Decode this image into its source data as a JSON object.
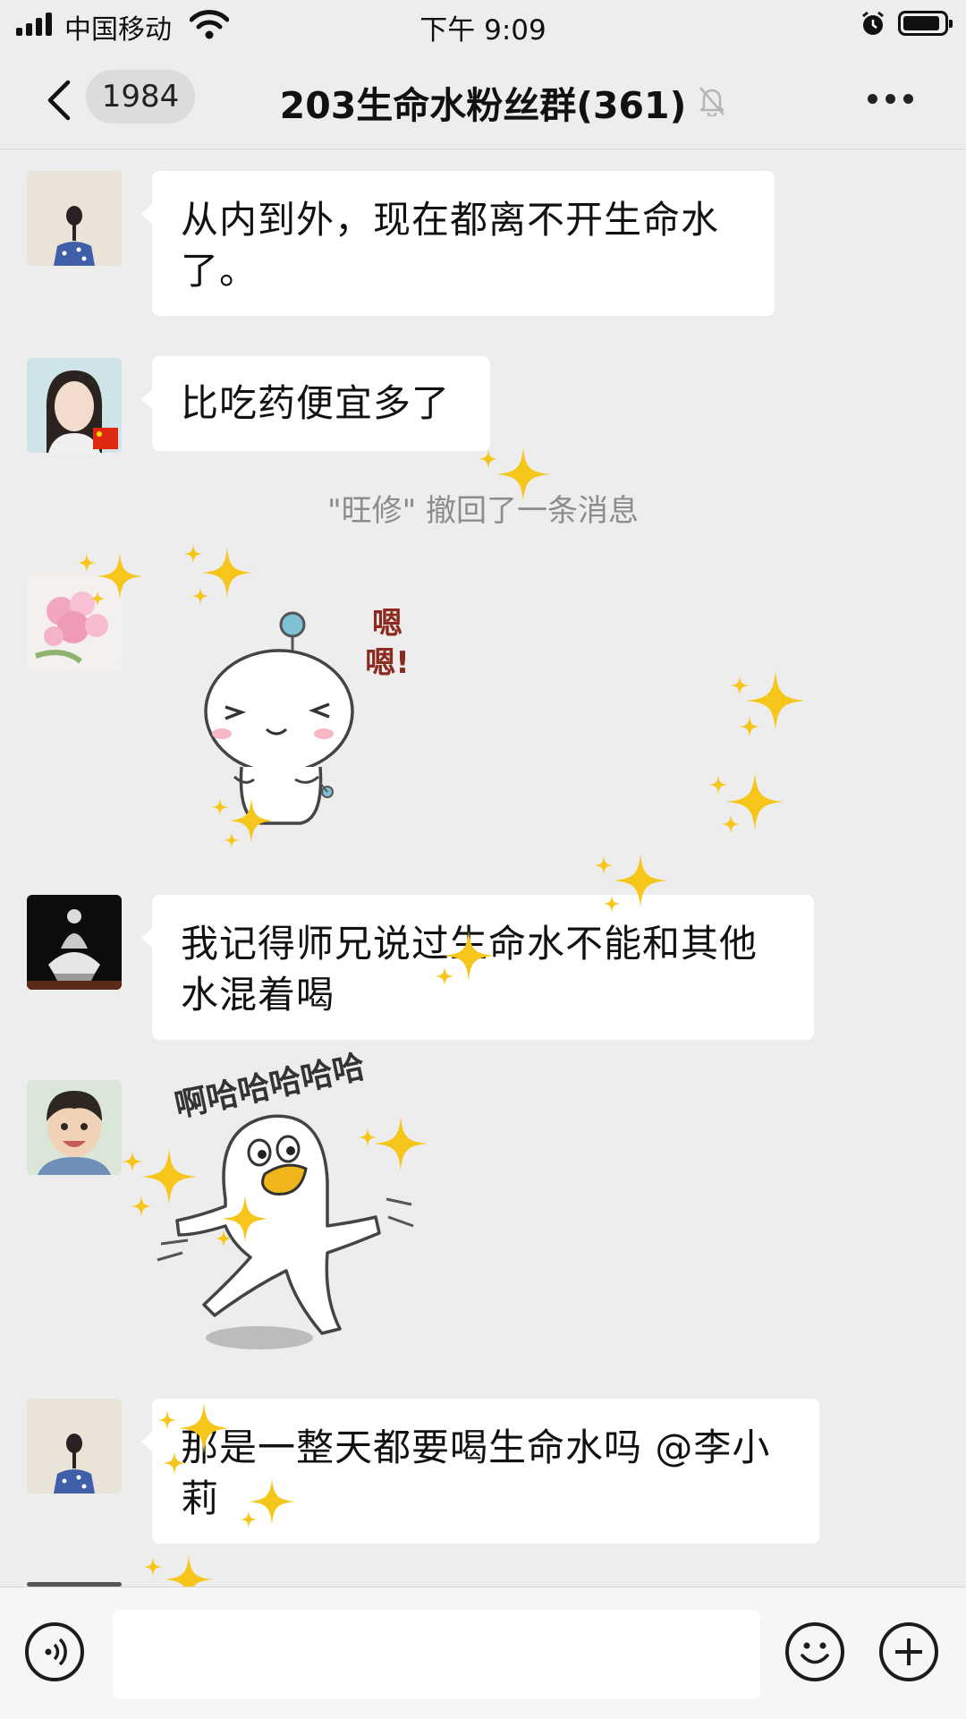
{
  "status_bar": {
    "carrier": "中国移动",
    "time": "下午 9:09"
  },
  "nav": {
    "unread_count": "1984",
    "title": "203生命水粉丝群(361)",
    "icons": [
      "back-chevron-icon",
      "mute-bell-icon",
      "more-dots-icon"
    ]
  },
  "messages": [
    {
      "type": "text",
      "text": "从内到外，现在都离不开生命水了。"
    },
    {
      "type": "text",
      "text": "比吃药便宜多了"
    },
    {
      "type": "system",
      "text": "\"旺修\" 撤回了一条消息"
    },
    {
      "type": "sticker",
      "caption": "嗯嗯!"
    },
    {
      "type": "text",
      "text": "我记得师兄说过生命水不能和其他水混着喝"
    },
    {
      "type": "sticker",
      "caption": "啊哈哈哈哈哈"
    },
    {
      "type": "text",
      "text": "那是一整天都要喝生命水吗 @李小莉"
    }
  ],
  "input_bar": {
    "icons": [
      "voice-icon",
      "emoji-icon",
      "plus-icon"
    ]
  },
  "colors": {
    "background": "#ededed",
    "bubble": "#ffffff",
    "sparkle": "#f7c61a"
  }
}
